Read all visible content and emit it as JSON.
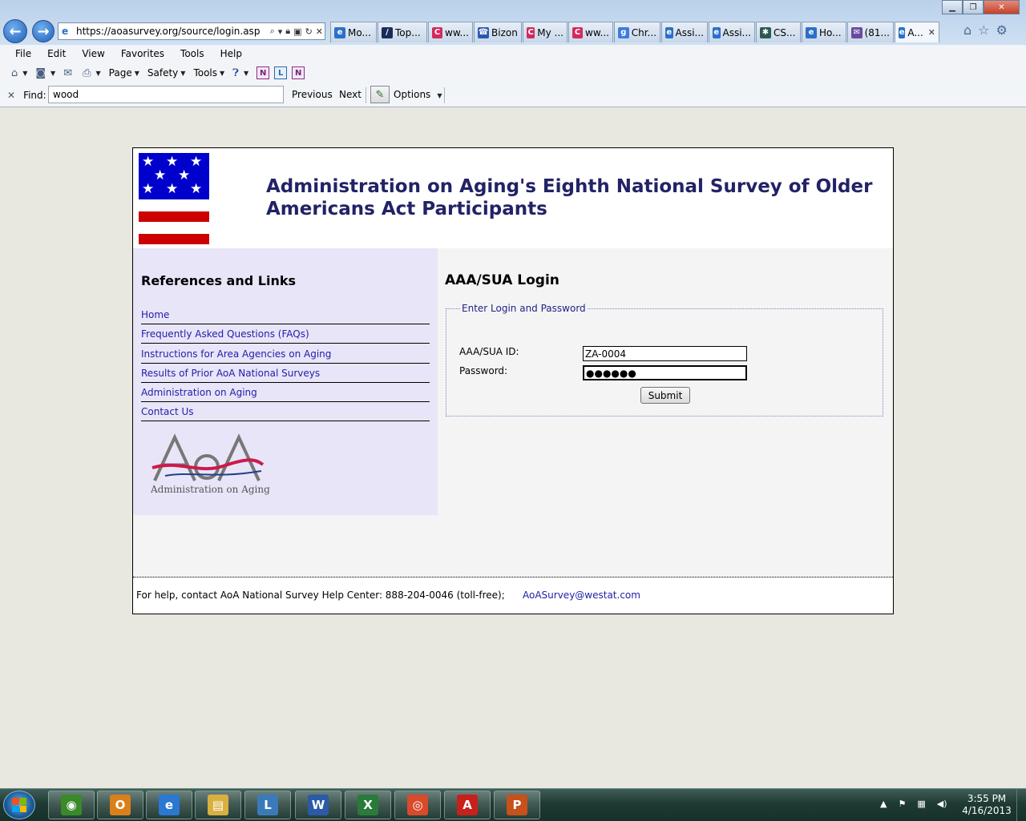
{
  "browser": {
    "url": "https://aoasurvey.org/source/login.asp",
    "tabs": [
      {
        "label": "Mo...",
        "icon": "ie-icon",
        "color": "#2a70c8",
        "glyph": "e"
      },
      {
        "label": "Top...",
        "icon": "topspin-icon",
        "color": "#1a2a5a",
        "glyph": "/"
      },
      {
        "label": "ww...",
        "icon": "c-brand-icon",
        "color": "#d42a5a",
        "glyph": "C"
      },
      {
        "label": "Bizon",
        "icon": "phone-icon",
        "color": "#2a5ab0",
        "glyph": "☎"
      },
      {
        "label": "My ...",
        "icon": "c-brand-icon",
        "color": "#d42a5a",
        "glyph": "C"
      },
      {
        "label": "ww...",
        "icon": "c-brand-icon",
        "color": "#d42a5a",
        "glyph": "C"
      },
      {
        "label": "Chr...",
        "icon": "google-icon",
        "color": "#3b7be0",
        "glyph": "g"
      },
      {
        "label": "Assi...",
        "icon": "ie-icon",
        "color": "#2a70c8",
        "glyph": "e"
      },
      {
        "label": "Assi...",
        "icon": "ie-icon",
        "color": "#2a70c8",
        "glyph": "e"
      },
      {
        "label": "CS...",
        "icon": "cs-icon",
        "color": "#2a5a50",
        "glyph": "✱"
      },
      {
        "label": "Ho...",
        "icon": "ie-icon",
        "color": "#2a70c8",
        "glyph": "e"
      },
      {
        "label": "(81...",
        "icon": "mail-icon",
        "color": "#6a4aa0",
        "glyph": "✉"
      },
      {
        "label": "A...",
        "icon": "ie-icon",
        "color": "#2a70c8",
        "glyph": "e",
        "active": true
      }
    ],
    "menu": [
      "File",
      "Edit",
      "View",
      "Favorites",
      "Tools",
      "Help"
    ],
    "commands": {
      "page": "Page",
      "safety": "Safety",
      "tools": "Tools"
    },
    "find": {
      "label": "Find:",
      "value": "wood",
      "previous": "Previous",
      "next": "Next",
      "options": "Options"
    }
  },
  "page": {
    "title": "Administration on Aging's Eighth National Survey of Older Americans Act Participants",
    "flag_colors": {
      "union": "#0000cc",
      "stripe": "#cc0000"
    },
    "sidebar": {
      "title": "References and Links",
      "links": [
        "Home",
        "Frequently Asked Questions (FAQs)",
        "Instructions for Area Agencies on Aging",
        "Results of Prior AoA National Surveys",
        "Administration on Aging",
        "Contact Us"
      ],
      "logo_caption": "Administration on Aging",
      "logo_text": "AoA"
    },
    "login": {
      "heading": "AAA/SUA Login",
      "legend": "Enter Login and Password",
      "id_label": "AAA/SUA ID:",
      "id_value": "ZA-0004",
      "password_label": "Password:",
      "password_value": "●●●●●●",
      "submit": "Submit"
    },
    "footer": {
      "help_text": "For help, contact AoA National Survey Help Center: 888-204-0046 (toll-free);",
      "email": "AoASurvey@westat.com"
    }
  },
  "taskbar": {
    "apps": [
      {
        "name": "chrome-canary-icon",
        "color": "#3a8a2a",
        "glyph": "◉"
      },
      {
        "name": "outlook-icon",
        "color": "#d8801a",
        "glyph": "O"
      },
      {
        "name": "internet-explorer-icon",
        "color": "#2a78d0",
        "glyph": "e"
      },
      {
        "name": "file-explorer-icon",
        "color": "#d8b040",
        "glyph": "▤"
      },
      {
        "name": "lync-icon",
        "color": "#3a7ab8",
        "glyph": "L"
      },
      {
        "name": "word-icon",
        "color": "#2a5aa8",
        "glyph": "W"
      },
      {
        "name": "excel-icon",
        "color": "#2a7a3a",
        "glyph": "X"
      },
      {
        "name": "chrome-icon",
        "color": "#d84a2a",
        "glyph": "◎"
      },
      {
        "name": "acrobat-icon",
        "color": "#c8201a",
        "glyph": "A"
      },
      {
        "name": "powerpoint-icon",
        "color": "#c8501a",
        "glyph": "P"
      }
    ],
    "time": "3:55 PM",
    "date": "4/16/2013"
  }
}
